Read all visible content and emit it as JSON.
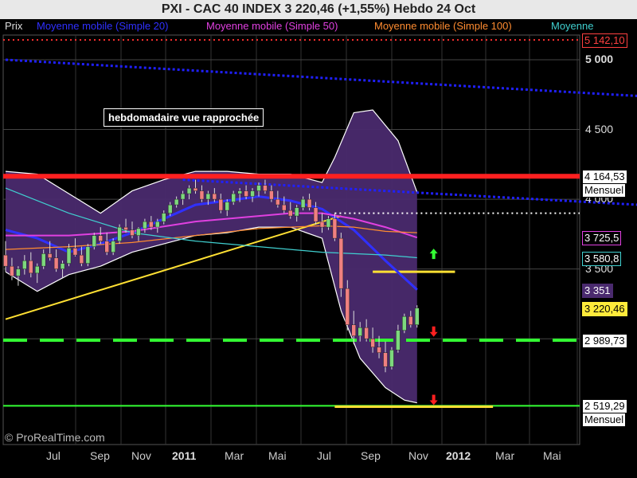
{
  "header": {
    "title": "PXI - CAC 40 INDEX     3 220,46 (+1,55%)     Hebdo  24 Oct"
  },
  "legend": [
    {
      "label": "Prix",
      "color": "#dddddd"
    },
    {
      "label": "Moyenne mobile (Simple 20)",
      "color": "#3030ff"
    },
    {
      "label": "Moyenne mobile (Simple 50)",
      "color": "#e040e0"
    },
    {
      "label": "Moyenne mobile (Simple 100)",
      "color": "#ff8c30"
    },
    {
      "label": "Moyenne",
      "color": "#40d0d0"
    }
  ],
  "annotation": "hebdomadaire vue rapprochée",
  "watermark": "© ProRealTime.com",
  "chart_data": {
    "type": "line",
    "x_ticks": [
      {
        "label": "Jul",
        "bold": false
      },
      {
        "label": "Sep",
        "bold": false
      },
      {
        "label": "Nov",
        "bold": false
      },
      {
        "label": "2011",
        "bold": true
      },
      {
        "label": "Mar",
        "bold": false
      },
      {
        "label": "Mai",
        "bold": false
      },
      {
        "label": "Jul",
        "bold": false
      },
      {
        "label": "Sep",
        "bold": false
      },
      {
        "label": "Nov",
        "bold": false
      },
      {
        "label": "2012",
        "bold": true
      },
      {
        "label": "Mar",
        "bold": false
      },
      {
        "label": "Mai",
        "bold": false
      }
    ],
    "y_ticks": [
      {
        "label": "5 000",
        "value": 5000,
        "bold": true
      },
      {
        "label": "4 500",
        "value": 4500,
        "bold": false
      },
      {
        "label": "4 000",
        "value": 4000,
        "bold": false
      },
      {
        "label": "3 500",
        "value": 3500,
        "bold": false
      },
      {
        "label": "3 000",
        "value": 3000,
        "bold": false
      }
    ],
    "ylim": [
      2380,
      5230
    ],
    "price_labels": [
      {
        "text": "5 142,10",
        "value": 5142.1,
        "bg": "#000000",
        "fg": "#ff4040",
        "border": "#ff4040"
      },
      {
        "text": "4 164,53",
        "sub": "Mensuel",
        "value": 4164.53,
        "bg": "#ffffff",
        "fg": "#000000",
        "border": "#000000"
      },
      {
        "text": "3 725,5",
        "value": 3725.5,
        "bg": "#000000",
        "fg": "#ffffff",
        "border": "#e040e0"
      },
      {
        "text": "3 580,8",
        "value": 3580.8,
        "bg": "#000000",
        "fg": "#ffffff",
        "border": "#40d0d0"
      },
      {
        "text": "3 351",
        "value": 3351,
        "bg": "#4a2a6e",
        "fg": "#ffffff",
        "border": "#4a2a6e"
      },
      {
        "text": "3 220,46",
        "value": 3220.46,
        "bg": "#ffeb3b",
        "fg": "#000000",
        "border": "#ffeb3b"
      },
      {
        "text": "2 989,73",
        "value": 2989.73,
        "bg": "#ffffff",
        "fg": "#000000",
        "border": "#000000"
      },
      {
        "text": "2 519,29",
        "sub": "Mensuel",
        "value": 2519.29,
        "bg": "#ffffff",
        "fg": "#000000",
        "border": "#000000"
      }
    ],
    "horizontal_lines": [
      {
        "name": "high-resistance",
        "value": 5142.1,
        "color": "#ff3030",
        "style": "dotted"
      },
      {
        "name": "monthly-resistance",
        "value": 4164.53,
        "color": "#ff2020",
        "style": "solid-thick"
      },
      {
        "name": "white-dotted-level",
        "value": 3900,
        "color": "#ffffff",
        "style": "dotted"
      },
      {
        "name": "weekly-support",
        "value": 2989.73,
        "color": "#33ff33",
        "style": "dashed"
      },
      {
        "name": "monthly-support",
        "value": 2519.29,
        "color": "#33ff33",
        "style": "solid"
      }
    ],
    "x_range_weeks": [
      0,
      100
    ],
    "candles": [
      [
        0,
        3600,
        3700,
        3480,
        3520
      ],
      [
        1,
        3520,
        3580,
        3420,
        3450
      ],
      [
        2,
        3450,
        3520,
        3380,
        3500
      ],
      [
        3,
        3500,
        3600,
        3460,
        3560
      ],
      [
        4,
        3560,
        3620,
        3440,
        3470
      ],
      [
        5,
        3470,
        3540,
        3400,
        3520
      ],
      [
        6,
        3520,
        3640,
        3500,
        3610
      ],
      [
        7,
        3610,
        3700,
        3560,
        3580
      ],
      [
        8,
        3580,
        3640,
        3480,
        3500
      ],
      [
        9,
        3500,
        3560,
        3440,
        3540
      ],
      [
        10,
        3540,
        3680,
        3520,
        3650
      ],
      [
        11,
        3650,
        3720,
        3590,
        3600
      ],
      [
        12,
        3600,
        3660,
        3520,
        3540
      ],
      [
        13,
        3540,
        3680,
        3520,
        3660
      ],
      [
        14,
        3660,
        3760,
        3640,
        3740
      ],
      [
        15,
        3740,
        3800,
        3680,
        3700
      ],
      [
        16,
        3700,
        3760,
        3600,
        3620
      ],
      [
        17,
        3620,
        3720,
        3600,
        3700
      ],
      [
        18,
        3700,
        3820,
        3680,
        3800
      ],
      [
        19,
        3800,
        3860,
        3760,
        3780
      ],
      [
        20,
        3780,
        3840,
        3720,
        3740
      ],
      [
        21,
        3740,
        3800,
        3700,
        3790
      ],
      [
        22,
        3790,
        3860,
        3760,
        3840
      ],
      [
        23,
        3840,
        3880,
        3780,
        3800
      ],
      [
        24,
        3800,
        3860,
        3760,
        3840
      ],
      [
        25,
        3840,
        3920,
        3820,
        3900
      ],
      [
        26,
        3900,
        3980,
        3880,
        3960
      ],
      [
        27,
        3960,
        4020,
        3940,
        4000
      ],
      [
        28,
        4000,
        4060,
        3960,
        4040
      ],
      [
        29,
        4040,
        4100,
        4000,
        4080
      ],
      [
        30,
        4080,
        4140,
        4040,
        4060
      ],
      [
        31,
        4060,
        4100,
        3980,
        4000
      ],
      [
        32,
        4000,
        4060,
        3960,
        4040
      ],
      [
        33,
        4040,
        4080,
        3980,
        4000
      ],
      [
        34,
        4000,
        4040,
        3900,
        3920
      ],
      [
        35,
        3920,
        4000,
        3880,
        3980
      ],
      [
        36,
        3980,
        4060,
        3960,
        4040
      ],
      [
        37,
        4040,
        4080,
        3980,
        4060
      ],
      [
        38,
        4060,
        4100,
        4000,
        4020
      ],
      [
        39,
        4020,
        4080,
        3980,
        4060
      ],
      [
        40,
        4060,
        4120,
        4020,
        4100
      ],
      [
        41,
        4100,
        4140,
        4040,
        4060
      ],
      [
        42,
        4060,
        4100,
        3980,
        4000
      ],
      [
        43,
        4000,
        4060,
        3940,
        3960
      ],
      [
        44,
        3960,
        4020,
        3900,
        3920
      ],
      [
        45,
        3920,
        3980,
        3860,
        3880
      ],
      [
        46,
        3880,
        3960,
        3840,
        3940
      ],
      [
        47,
        3940,
        4020,
        3920,
        4000
      ],
      [
        48,
        4000,
        4040,
        3920,
        3940
      ],
      [
        49,
        3940,
        3980,
        3820,
        3840
      ],
      [
        50,
        3840,
        3900,
        3760,
        3800
      ],
      [
        51,
        3800,
        3880,
        3780,
        3860
      ],
      [
        52,
        3860,
        3900,
        3700,
        3720
      ],
      [
        53,
        3720,
        3760,
        3300,
        3360
      ],
      [
        54,
        3360,
        3420,
        3060,
        3100
      ],
      [
        55,
        3100,
        3200,
        2960,
        3020
      ],
      [
        56,
        3020,
        3120,
        2980,
        3080
      ],
      [
        57,
        3080,
        3140,
        2980,
        3000
      ],
      [
        58,
        3000,
        3080,
        2900,
        2940
      ],
      [
        59,
        2940,
        3020,
        2860,
        2900
      ],
      [
        60,
        2900,
        2980,
        2760,
        2800
      ],
      [
        61,
        2800,
        2940,
        2780,
        2920
      ],
      [
        62,
        2920,
        3100,
        2900,
        3060
      ],
      [
        63,
        3060,
        3180,
        3040,
        3160
      ],
      [
        64,
        3160,
        3200,
        3080,
        3100
      ],
      [
        65,
        3100,
        3240,
        3080,
        3220
      ]
    ],
    "series": [
      {
        "key": "sma20",
        "points": [
          [
            0,
            3780
          ],
          [
            5,
            3720
          ],
          [
            10,
            3620
          ],
          [
            15,
            3680
          ],
          [
            20,
            3760
          ],
          [
            25,
            3860
          ],
          [
            30,
            3960
          ],
          [
            35,
            3990
          ],
          [
            40,
            4020
          ],
          [
            45,
            3990
          ],
          [
            50,
            3930
          ],
          [
            55,
            3780
          ],
          [
            60,
            3560
          ],
          [
            65,
            3351
          ]
        ]
      },
      {
        "key": "sma50",
        "points": [
          [
            0,
            3740
          ],
          [
            10,
            3740
          ],
          [
            20,
            3770
          ],
          [
            30,
            3840
          ],
          [
            40,
            3880
          ],
          [
            45,
            3900
          ],
          [
            50,
            3900
          ],
          [
            55,
            3860
          ],
          [
            60,
            3800
          ],
          [
            65,
            3725.5
          ]
        ]
      },
      {
        "key": "sma100",
        "points": [
          [
            0,
            3640
          ],
          [
            10,
            3660
          ],
          [
            20,
            3690
          ],
          [
            30,
            3740
          ],
          [
            40,
            3790
          ],
          [
            50,
            3810
          ],
          [
            55,
            3800
          ],
          [
            60,
            3770
          ],
          [
            65,
            3760
          ]
        ]
      },
      {
        "key": "avg",
        "points": [
          [
            0,
            4080
          ],
          [
            10,
            3900
          ],
          [
            20,
            3760
          ],
          [
            30,
            3700
          ],
          [
            40,
            3660
          ],
          [
            50,
            3620
          ],
          [
            60,
            3600
          ],
          [
            65,
            3580.8
          ]
        ]
      }
    ],
    "bollinger": {
      "upper": [
        [
          0,
          4200
        ],
        [
          5,
          4180
        ],
        [
          10,
          4040
        ],
        [
          15,
          3900
        ],
        [
          20,
          4060
        ],
        [
          25,
          4140
        ],
        [
          30,
          4200
        ],
        [
          35,
          4200
        ],
        [
          40,
          4180
        ],
        [
          45,
          4180
        ],
        [
          50,
          4120
        ],
        [
          52,
          4300
        ],
        [
          55,
          4620
        ],
        [
          58,
          4640
        ],
        [
          62,
          4420
        ],
        [
          65,
          4050
        ]
      ],
      "lower": [
        [
          0,
          3480
        ],
        [
          5,
          3340
        ],
        [
          10,
          3460
        ],
        [
          15,
          3520
        ],
        [
          20,
          3620
        ],
        [
          25,
          3680
        ],
        [
          30,
          3740
        ],
        [
          35,
          3760
        ],
        [
          40,
          3800
        ],
        [
          45,
          3800
        ],
        [
          50,
          3720
        ],
        [
          53,
          3200
        ],
        [
          56,
          2860
        ],
        [
          60,
          2650
        ],
        [
          63,
          2560
        ],
        [
          65,
          2540
        ]
      ]
    },
    "trendlines": [
      {
        "name": "rising-support",
        "color": "#ffe033",
        "from": [
          0,
          3140
        ],
        "to": [
          53,
          3880
        ]
      },
      {
        "name": "falling-long-trend",
        "color": "#2020ff",
        "from": [
          0,
          5000
        ],
        "to": [
          100,
          4740
        ]
      },
      {
        "name": "falling-mid-trend",
        "color": "#2020ff",
        "from": [
          28,
          4140
        ],
        "to": [
          100,
          3960
        ]
      }
    ],
    "short_lines": [
      {
        "name": "yellow-3500",
        "color": "#ffe033",
        "from": [
          58,
          3480
        ],
        "to": [
          71,
          3480
        ]
      },
      {
        "name": "yellow-bottom",
        "color": "#ffe033",
        "from": [
          52,
          2513
        ],
        "to": [
          77,
          2513
        ]
      },
      {
        "name": "white-dotted-level",
        "color": "#ffffff",
        "from": [
          52,
          3880
        ],
        "to": [
          95,
          3880
        ]
      }
    ],
    "arrows": [
      {
        "name": "up-arrow",
        "week": 67,
        "value": 3600,
        "color": "#33ff33",
        "direction": "up"
      },
      {
        "name": "down-arrow-1",
        "week": 67,
        "value": 3060,
        "color": "#ff2020",
        "direction": "down"
      },
      {
        "name": "down-arrow-2",
        "week": 67,
        "value": 2570,
        "color": "#ff2020",
        "direction": "down"
      }
    ]
  }
}
